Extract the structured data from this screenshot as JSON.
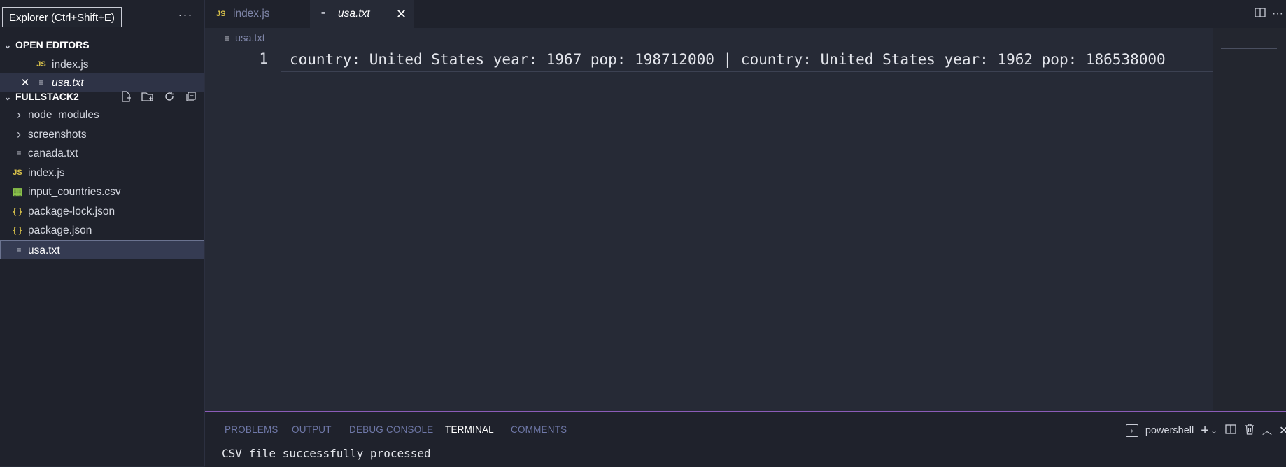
{
  "sidebar": {
    "tooltip": "Explorer (Ctrl+Shift+E)",
    "more_label": "···",
    "open_editors": {
      "title": "OPEN EDITORS",
      "items": [
        {
          "icon": "JS",
          "label": "index.js"
        },
        {
          "icon": "≡",
          "label": "usa.txt",
          "close": "✕"
        }
      ]
    },
    "project": {
      "title": "FULLSTACK2",
      "items": [
        {
          "icon": "›",
          "label": "node_modules"
        },
        {
          "icon": "›",
          "label": "screenshots"
        },
        {
          "icon": "≡",
          "label": "canada.txt"
        },
        {
          "icon": "JS",
          "label": "index.js"
        },
        {
          "icon": "▦",
          "label": "input_countries.csv"
        },
        {
          "icon": "{ }",
          "label": "package-lock.json"
        },
        {
          "icon": "{ }",
          "label": "package.json"
        },
        {
          "icon": "≡",
          "label": "usa.txt"
        }
      ]
    }
  },
  "tabs": [
    {
      "icon": "JS",
      "label": "index.js"
    },
    {
      "icon": "≡",
      "label": "usa.txt",
      "close": "✕"
    }
  ],
  "breadcrumb": {
    "icon": "≡",
    "label": "usa.txt"
  },
  "editor": {
    "line_number": "1",
    "line_text": "country: United States year: 1967 pop: 198712000 | country: United States year: 1962 pop: 186538000"
  },
  "panel": {
    "tabs": [
      "PROBLEMS",
      "OUTPUT",
      "DEBUG CONSOLE",
      "TERMINAL",
      "COMMENTS"
    ],
    "active_tab": "TERMINAL",
    "shell_label": "powershell",
    "output": "CSV file successfully processed"
  },
  "colors": {
    "accent": "#b57be0",
    "background": "#262a36",
    "sidebar": "#1f222c"
  }
}
